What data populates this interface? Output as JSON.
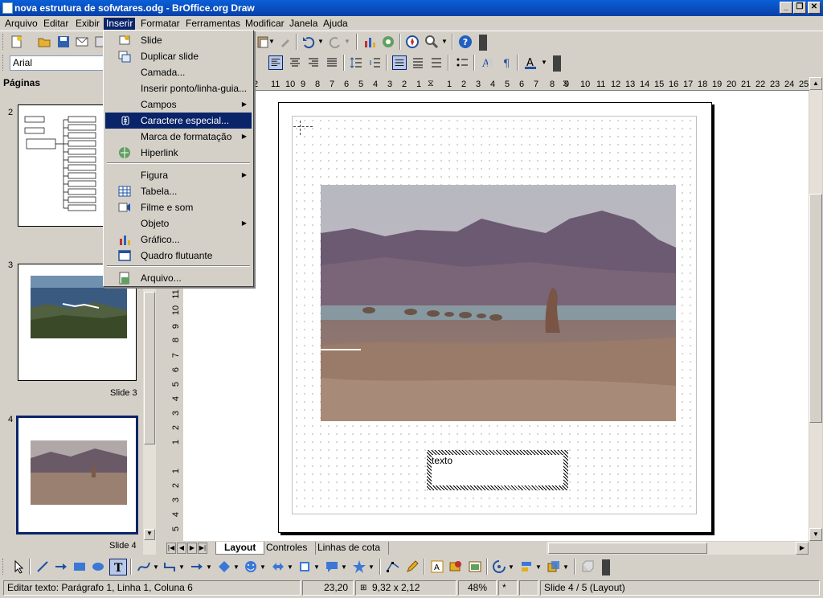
{
  "window": {
    "title": "nova estrutura de sofwtares.odg - BrOffice.org Draw"
  },
  "menubar": {
    "items": [
      {
        "label": "Arquivo"
      },
      {
        "label": "Editar"
      },
      {
        "label": "Exibir"
      },
      {
        "label": "Inserir"
      },
      {
        "label": "Formatar"
      },
      {
        "label": "Ferramentas"
      },
      {
        "label": "Modificar"
      },
      {
        "label": "Janela"
      },
      {
        "label": "Ajuda"
      }
    ]
  },
  "insert_menu": {
    "items": [
      {
        "label": "Slide",
        "icon": "slide-icon"
      },
      {
        "label": "Duplicar slide",
        "icon": "duplicate-slide-icon"
      },
      {
        "label": "Camada...",
        "icon": ""
      },
      {
        "label": "Inserir ponto/linha-guia...",
        "icon": ""
      },
      {
        "label": "Campos",
        "icon": "",
        "submenu": true
      },
      {
        "label": "Caractere especial...",
        "icon": "special-character-icon",
        "highlighted": true
      },
      {
        "label": "Marca de formatação",
        "icon": "",
        "submenu": true
      },
      {
        "label": "Hiperlink",
        "icon": "hyperlink-icon"
      },
      {
        "label": "Figura",
        "icon": "",
        "submenu": true
      },
      {
        "label": "Tabela...",
        "icon": "table-icon"
      },
      {
        "label": "Filme e som",
        "icon": "movie-sound-icon"
      },
      {
        "label": "Objeto",
        "icon": "",
        "submenu": true
      },
      {
        "label": "Gráfico...",
        "icon": "chart-icon"
      },
      {
        "label": "Quadro flutuante",
        "icon": "floating-frame-icon"
      },
      {
        "label": "Arquivo...",
        "icon": "file-icon"
      }
    ]
  },
  "font": {
    "name": "Arial"
  },
  "pages_panel": {
    "title": "Páginas",
    "slides": [
      {
        "number": "2",
        "caption": ""
      },
      {
        "number": "3",
        "caption": "Slide 3"
      },
      {
        "number": "4",
        "caption": "Slide 4"
      }
    ]
  },
  "ruler": {
    "h_labels": [
      "2",
      "11",
      "10",
      "9",
      "8",
      "7",
      "6",
      "5",
      "4",
      "3",
      "2",
      "1",
      "1",
      "2",
      "3",
      "4",
      "5",
      "6",
      "7",
      "8",
      "9",
      "10",
      "11",
      "12",
      "13",
      "14",
      "15",
      "16",
      "17",
      "18",
      "19",
      "20",
      "21",
      "22",
      "23",
      "24",
      "25"
    ],
    "v_labels": [
      "11",
      "10",
      "9",
      "8",
      "7",
      "6",
      "5",
      "4",
      "3",
      "2",
      "1",
      "1",
      "2",
      "3",
      "4",
      "5"
    ]
  },
  "canvas": {
    "text_box": "texto"
  },
  "tabs": [
    {
      "label": "Layout",
      "active": true
    },
    {
      "label": "Controles",
      "active": false
    },
    {
      "label": "Linhas de cota",
      "active": false
    }
  ],
  "status": {
    "edit_text": "Editar texto: Parágrafo 1, Linha 1, Coluna 6",
    "position": "23,20",
    "size": "9,32 x 2,12",
    "zoom": "48%",
    "modified": "*",
    "slide": "Slide 4 / 5 (Layout)"
  }
}
